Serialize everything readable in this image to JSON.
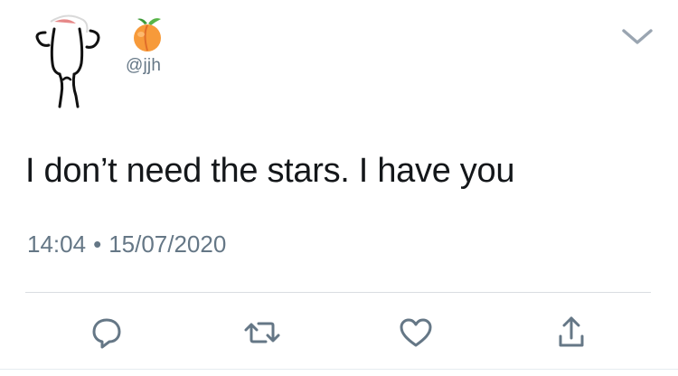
{
  "tweet": {
    "handle": "@jjh",
    "name_emoji": "peach-icon",
    "text": "I don’t need the stars. I have you",
    "time": "14:04",
    "separator": "•",
    "date": "15/07/2020"
  },
  "icons": {
    "menu": "chevron-down-icon",
    "reply": "reply-icon",
    "retweet": "retweet-icon",
    "like": "heart-icon",
    "share": "share-icon"
  },
  "colors": {
    "text": "#14171a",
    "secondary": "#657786",
    "icon": "#657786",
    "divider": "#d9dde1",
    "peach": "#f79a3a"
  }
}
